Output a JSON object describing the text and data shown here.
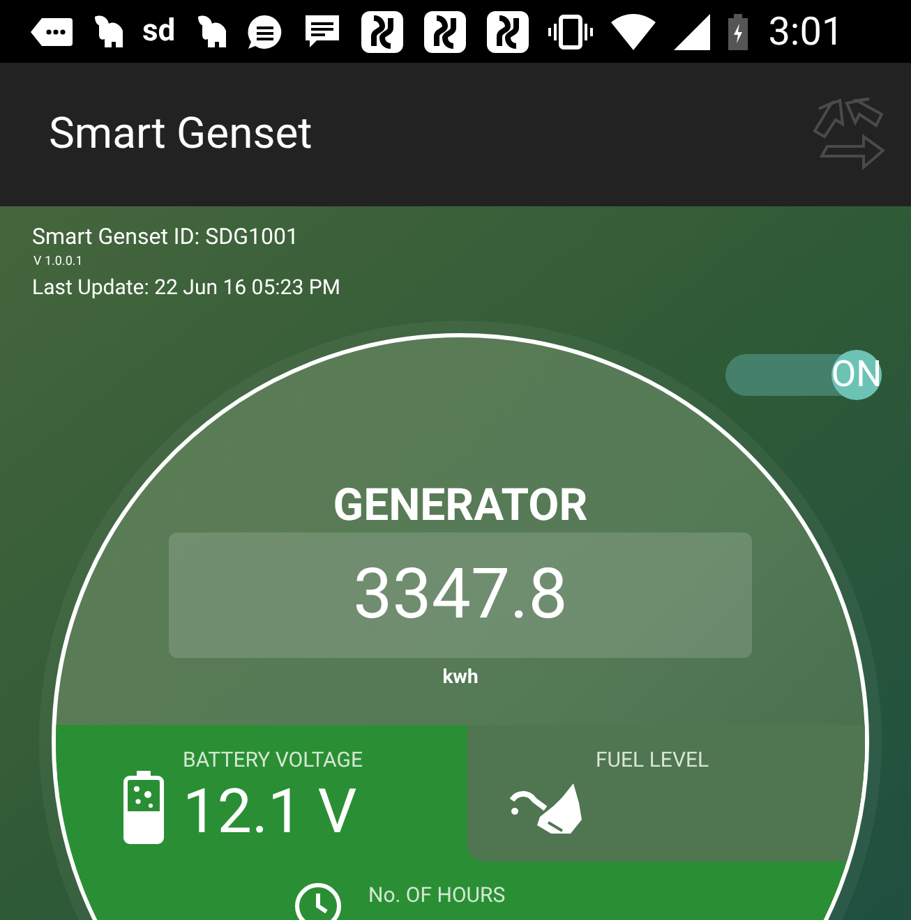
{
  "status_bar": {
    "notification_text": "sd",
    "time": "3:01"
  },
  "app_bar": {
    "title": "Smart Genset"
  },
  "info": {
    "device_id": "Smart Genset ID: SDG1001",
    "version": "V 1.0.0.1",
    "last_update": "Last Update: 22 Jun 16 05:23 PM"
  },
  "toggle": {
    "label": "ON",
    "on": true
  },
  "generator": {
    "title": "GENERATOR",
    "reading": "3347.8",
    "unit": "kwh"
  },
  "tiles": [
    {
      "kind": "battery",
      "label": "BATTERY VOLTAGE",
      "value": "12.1 V"
    },
    {
      "kind": "fuel",
      "label": "FUEL LEVEL"
    },
    {
      "kind": "hours",
      "label": "No. OF HOURS"
    }
  ]
}
